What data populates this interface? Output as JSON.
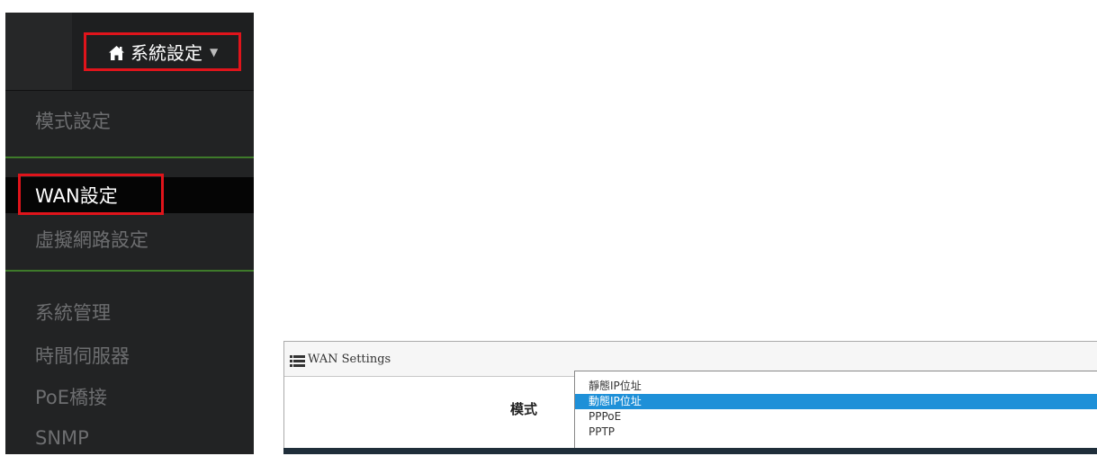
{
  "sidebar": {
    "header_button": {
      "label": "系統設定",
      "icon": "home-icon",
      "caret": "caret-down-icon"
    },
    "items": [
      {
        "label": "模式設定"
      },
      {
        "label": "WAN設定",
        "active": true
      },
      {
        "label": "虛擬網路設定"
      },
      {
        "label": "系統管理"
      },
      {
        "label": "時間伺服器"
      },
      {
        "label": "PoE橋接"
      },
      {
        "label": "SNMP"
      }
    ],
    "colors": {
      "background": "#222324",
      "active_background": "#050505",
      "highlight_border": "#e0141b",
      "divider": "#3e7a2a"
    }
  },
  "wan_panel": {
    "title": "WAN Settings",
    "icon": "list-icon",
    "mode_label": "模式",
    "mode_options": [
      "靜態IP位址",
      "動態IP位址",
      "PPPoE",
      "PPTP"
    ],
    "selected_option": "動態IP位址",
    "colors": {
      "selected": "#1e90d8"
    }
  }
}
